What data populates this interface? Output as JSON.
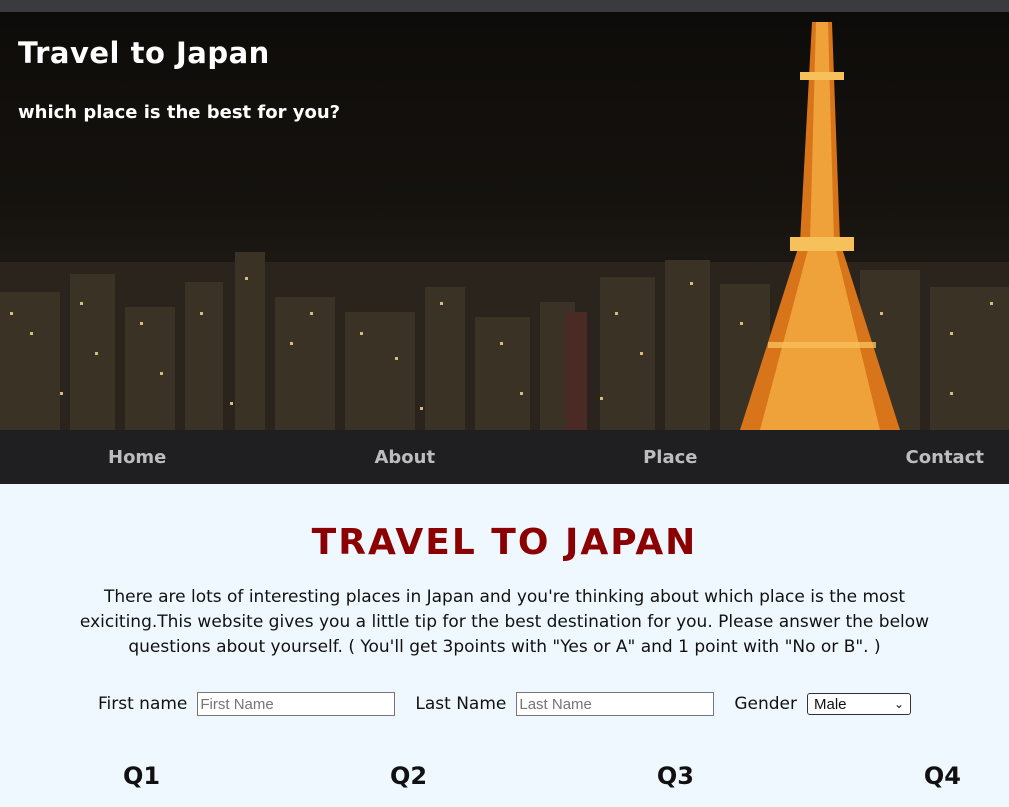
{
  "header": {
    "title": "Travel to Japan",
    "subtitle": "which place is the best for you?",
    "hero_image": "tokyo-tower-night-city-photo"
  },
  "nav": {
    "items": [
      {
        "label": "Home"
      },
      {
        "label": "About"
      },
      {
        "label": "Place"
      },
      {
        "label": "Contact"
      }
    ]
  },
  "main": {
    "title": "TRAVEL TO JAPAN",
    "intro": "There are lots of interesting places in Japan and you're thinking about which place is the most exiciting.This website gives you a little tip for the best destination for you. Please answer the below questions about yourself. ( You'll get 3points with \"Yes or A\" and 1 point with \"No or B\". )"
  },
  "form": {
    "first_name_label": "First name",
    "first_name_placeholder": "First Name",
    "last_name_label": "Last Name",
    "last_name_placeholder": "Last Name",
    "gender_label": "Gender",
    "gender_value": "Male"
  },
  "questions": [
    "Q1",
    "Q2",
    "Q3",
    "Q4"
  ],
  "colors": {
    "title_red": "#8b0000",
    "nav_bg": "#1f1f22",
    "page_bg": "#f0f8ff"
  }
}
